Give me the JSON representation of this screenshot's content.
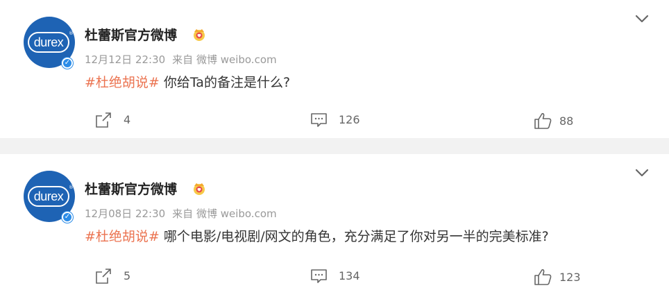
{
  "posts": [
    {
      "avatar_text": "durex",
      "author": "杜蕾斯官方微博",
      "date": "12月12日 22:30",
      "source": "来自 微博 weibo.com",
      "hashtag": "#杜绝胡说#",
      "text": "你给Ta的备注是什么?",
      "reposts": "4",
      "comments": "126",
      "likes": "88"
    },
    {
      "avatar_text": "durex",
      "author": "杜蕾斯官方微博",
      "date": "12月08日 22:30",
      "source": "来自 微博 weibo.com",
      "hashtag": "#杜绝胡说#",
      "text": "哪个电影/电视剧/网文的角色，充分满足了你对另一半的完美标准?",
      "reposts": "5",
      "comments": "134",
      "likes": "123"
    }
  ],
  "icons": {
    "brand_color": "#1e63b4",
    "hashtag_color": "#eb7350",
    "verified_color": "#2b8ce8",
    "crown": "crown-icon",
    "more": "chevron-down-icon",
    "repost": "share-icon",
    "comment": "comment-icon",
    "like": "thumbs-up-icon"
  }
}
